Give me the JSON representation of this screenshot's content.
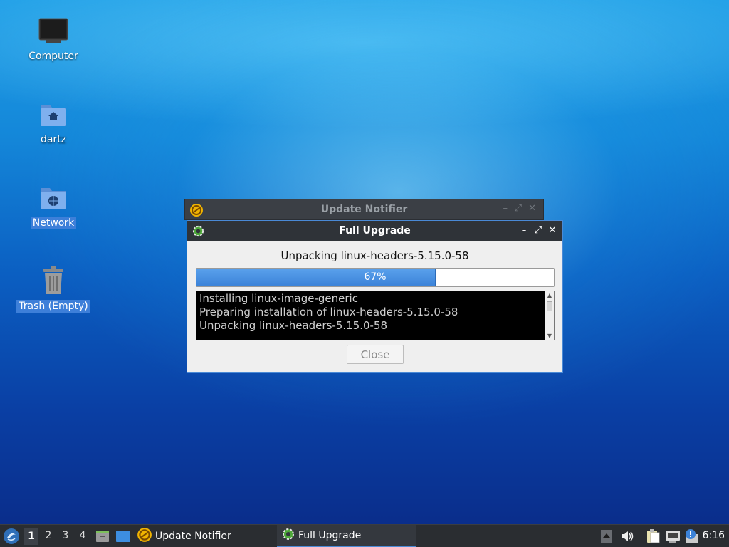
{
  "desktop": {
    "icons": [
      {
        "label": "Computer"
      },
      {
        "label": "dartz"
      },
      {
        "label": "Network"
      },
      {
        "label": "Trash (Empty)"
      }
    ]
  },
  "back_window": {
    "title": "Update Notifier",
    "icon": "update-notifier-icon"
  },
  "dialog": {
    "title": "Full Upgrade",
    "icon": "gear-icon",
    "status": "Unpacking linux-headers-5.15.0-58",
    "progress_percent": 67,
    "progress_label": "67%",
    "log_lines": [
      "Installing linux-image-generic",
      "Preparing installation of linux-headers-5.15.0-58",
      "Unpacking linux-headers-5.15.0-58"
    ],
    "close_label": "Close",
    "controls": {
      "minimize": "–",
      "maximize": "⤢",
      "close": "✕"
    }
  },
  "taskbar": {
    "workspaces": [
      "1",
      "2",
      "3",
      "4"
    ],
    "active_workspace": "1",
    "tasks": [
      {
        "label": "Update Notifier",
        "icon": "update-notifier-icon"
      },
      {
        "label": "Full Upgrade",
        "icon": "gear-icon"
      }
    ],
    "clock": "6:16"
  },
  "colors": {
    "accent": "#3d7fd9",
    "progress_fill": "#3b82d8",
    "titlebar": "#2f3338",
    "taskbar": "#2a2d31"
  }
}
